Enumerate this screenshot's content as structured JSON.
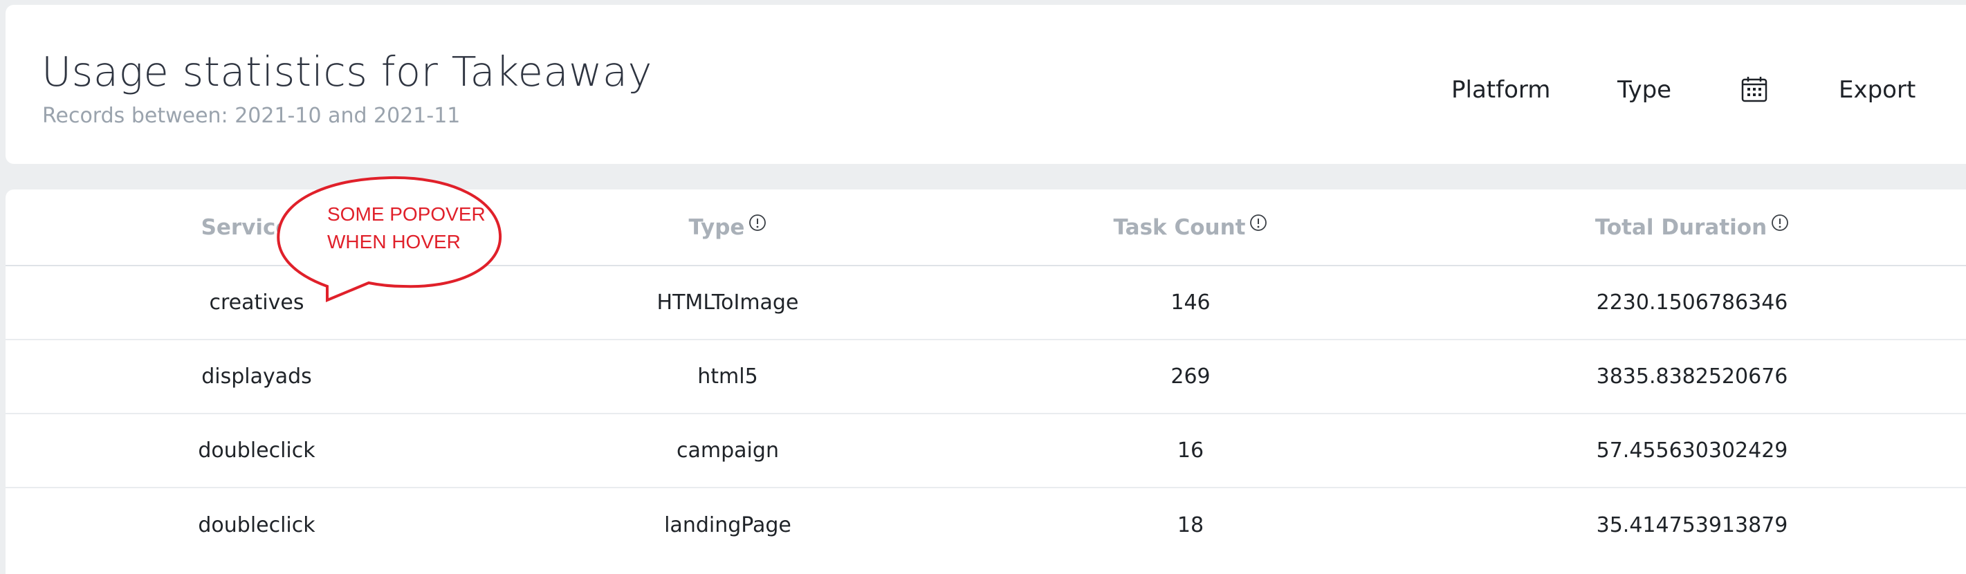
{
  "header": {
    "title": "Usage statistics for Takeaway",
    "subtitle": "Records between: 2021-10 and 2021-11",
    "nav": {
      "platform": "Platform",
      "type": "Type",
      "calendar_icon": "calendar-icon",
      "export": "Export"
    }
  },
  "table": {
    "columns": [
      "Service",
      "Type",
      "Task Count",
      "Total Duration"
    ],
    "info_icon": "info-icon",
    "rows": [
      [
        "creatives",
        "HTMLToImage",
        "146",
        "2230.1506786346"
      ],
      [
        "displayads",
        "html5",
        "269",
        "3835.8382520676"
      ],
      [
        "doubleclick",
        "campaign",
        "16",
        "57.455630302429"
      ],
      [
        "doubleclick",
        "landingPage",
        "18",
        "35.414753913879"
      ]
    ]
  },
  "annotation": {
    "line1": "SOME POPOVER",
    "line2": "WHEN HOVER",
    "color": "#e0202a"
  },
  "colors": {
    "background": "#eceef0",
    "card": "#ffffff",
    "header_text": "#a9b0b8"
  }
}
